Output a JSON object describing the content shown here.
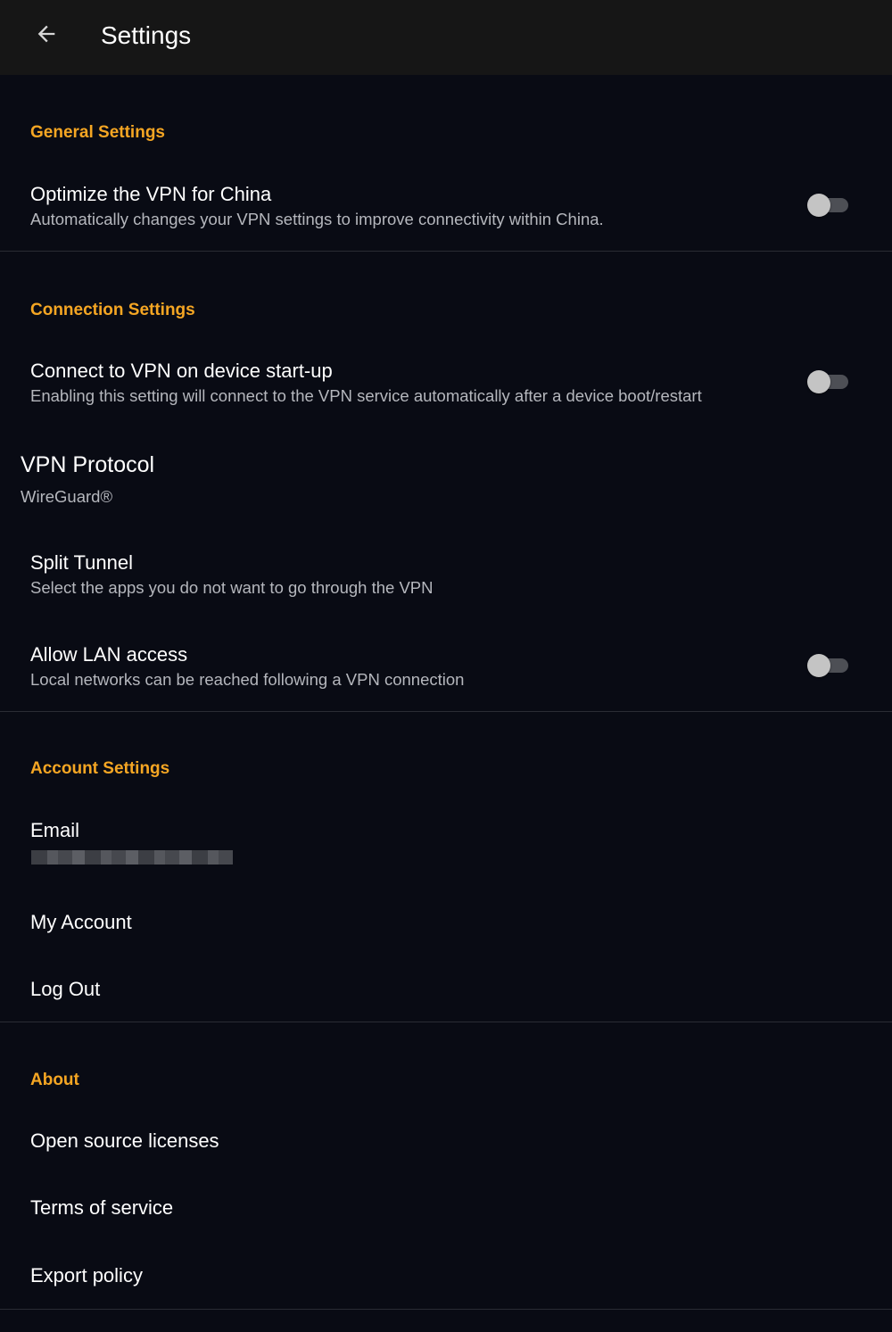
{
  "app_bar": {
    "title": "Settings",
    "back_icon": "arrow-left-icon"
  },
  "colors": {
    "background": "#090b14",
    "app_bar": "#161616",
    "accent": "#f5a623",
    "text_primary": "#ffffff",
    "text_secondary": "#b5b7bd"
  },
  "sections": {
    "general": {
      "header": "General Settings",
      "optimize_china": {
        "title": "Optimize the VPN for China",
        "subtitle": "Automatically changes your VPN settings to improve connectivity within China.",
        "enabled": false
      }
    },
    "connection": {
      "header": "Connection Settings",
      "connect_on_startup": {
        "title": "Connect to VPN on device start-up",
        "subtitle": "Enabling this setting will connect to the VPN service automatically after a device boot/restart",
        "enabled": false
      },
      "vpn_protocol": {
        "title": "VPN Protocol",
        "value": "WireGuard®"
      },
      "split_tunnel": {
        "title": "Split Tunnel",
        "subtitle": "Select the apps you do not want to go through the VPN"
      },
      "lan_access": {
        "title": "Allow LAN access",
        "subtitle": "Local networks can be reached following a VPN connection",
        "enabled": false
      }
    },
    "account": {
      "header": "Account Settings",
      "email": {
        "title": "Email"
      },
      "my_account": {
        "title": "My Account"
      },
      "log_out": {
        "title": "Log Out"
      }
    },
    "about": {
      "header": "About",
      "licenses": {
        "title": "Open source licenses"
      },
      "terms": {
        "title": "Terms of service"
      },
      "export_policy": {
        "title": "Export policy"
      }
    }
  }
}
